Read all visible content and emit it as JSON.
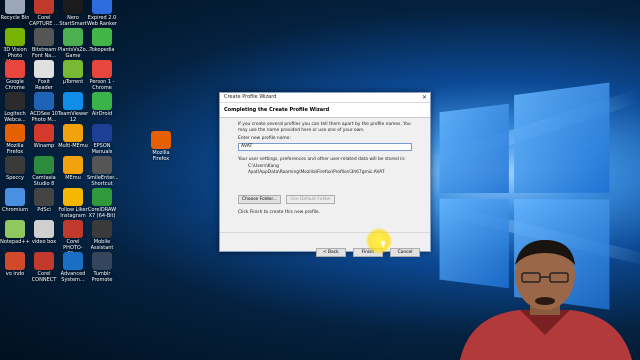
{
  "desktop": {
    "icons": [
      {
        "label": "Recycle Bin",
        "color": "#9aa7b8",
        "icon": "recycle-bin-icon"
      },
      {
        "label": "Corel\nCAPTURE ...",
        "color": "#c0392b",
        "icon": "corel-capture-icon"
      },
      {
        "label": "Nero\nStartSmart",
        "color": "#1b1b1b",
        "icon": "nero-icon"
      },
      {
        "label": "Expired 2.0\nWeb Ranker",
        "color": "#2d6cdf",
        "icon": "web-ranker-icon"
      },
      {
        "label": "3D Vision\nPhoto Viewer",
        "color": "#77b300",
        "icon": "3d-vision-icon"
      },
      {
        "label": "Bitstream\nFont Na...",
        "color": "#555555",
        "icon": "bitstream-icon"
      },
      {
        "label": "PlantsVsZo...\nGame",
        "color": "#4caf50",
        "icon": "plants-vs-zombies-icon"
      },
      {
        "label": "Tokopedia",
        "color": "#42b549",
        "icon": "tokopedia-icon"
      },
      {
        "label": "Google\nChrome",
        "color": "#e8453c",
        "icon": "chrome-icon"
      },
      {
        "label": "Foxit Reader",
        "color": "#e0e0e0",
        "icon": "foxit-reader-icon"
      },
      {
        "label": "μTorrent",
        "color": "#78b833",
        "icon": "utorrent-icon"
      },
      {
        "label": "Person 1 -\nChrome",
        "color": "#e8453c",
        "icon": "chrome-icon"
      },
      {
        "label": "Logitech\nWebca...",
        "color": "#2b2b2b",
        "icon": "logitech-icon"
      },
      {
        "label": "ACDSee 10\nPhoto M...",
        "color": "#1e63b5",
        "icon": "acdsee-icon"
      },
      {
        "label": "TeamViewer\n12",
        "color": "#0e8ee9",
        "icon": "teamviewer-icon"
      },
      {
        "label": "AirDroid",
        "color": "#3ab34a",
        "icon": "airdroid-icon"
      },
      {
        "label": "Mozilla\nFirefox",
        "color": "#e66000",
        "icon": "firefox-icon"
      },
      {
        "label": "Winamp",
        "color": "#d33a2c",
        "icon": "winamp-icon"
      },
      {
        "label": "Multi-MEmu",
        "color": "#f2a20c",
        "icon": "memu-icon"
      },
      {
        "label": "EPSON\nManuals",
        "color": "#1e3f96",
        "icon": "epson-icon"
      },
      {
        "label": "Speccy",
        "color": "#3a3a3a",
        "icon": "speccy-icon"
      },
      {
        "label": "Camtasia\nStudio 8",
        "color": "#2d8c3c",
        "icon": "camtasia-icon"
      },
      {
        "label": "MEmu",
        "color": "#f2a20c",
        "icon": "memu-icon"
      },
      {
        "label": "SmileEnter...\nShortcut",
        "color": "#555555",
        "icon": "shortcut-icon"
      },
      {
        "label": "Chromium",
        "color": "#4a90e2",
        "icon": "chromium-icon"
      },
      {
        "label": "PdSci",
        "color": "#444444",
        "icon": "pdsci-icon"
      },
      {
        "label": "Follow Liker\nInstagram",
        "color": "#f5b700",
        "icon": "follow-liker-icon"
      },
      {
        "label": "CorelDRAW\nX7 (64-Bit)",
        "color": "#2f9a3a",
        "icon": "coreldraw-icon"
      },
      {
        "label": "Notepad++",
        "color": "#8fc85f",
        "icon": "notepad-plus-icon"
      },
      {
        "label": "video box",
        "color": "#cfcfcf",
        "icon": "video-box-icon"
      },
      {
        "label": "Corel\nPHOTO-PA...",
        "color": "#c0392b",
        "icon": "corel-photopaint-icon"
      },
      {
        "label": "Mobile\nAssistant",
        "color": "#3a3a3a",
        "icon": "mobile-assistant-icon"
      },
      {
        "label": "vo indo",
        "color": "#d04a2a",
        "icon": "vo-indo-icon"
      },
      {
        "label": "Corel\nCONNECT",
        "color": "#c0392b",
        "icon": "corel-connect-icon"
      },
      {
        "label": "Advanced\nSystem...",
        "color": "#1a6fc4",
        "icon": "advanced-system-icon"
      },
      {
        "label": "Tumblr\nPromote",
        "color": "#35465c",
        "icon": "tumblr-icon"
      },
      {
        "label": "Mozilla\nFirefox",
        "color": "#e66000",
        "icon": "firefox-icon"
      }
    ]
  },
  "dialog": {
    "title": "Create Profile Wizard",
    "close_symbol": "✕",
    "header": "Completing the Create Profile Wizard",
    "intro": "If you create several profiles you can tell them apart by the profile names. You may use the name provided here or use one of your own.",
    "name_label": "Enter new profile name:",
    "name_value": "AVAT",
    "settings_text": "Your user settings, preferences and other user-related data will be stored in:",
    "path_text": "C:\\Users\\Kang Ayat\\AppData\\Roaming\\Mozilla\\Firefox\\Profiles\\3h67gmic.AVAT",
    "choose_folder": "Choose Folder...",
    "use_default": "Use Default Folder",
    "finish_hint": "Click Finish to create this new profile.",
    "back": "< Back",
    "finish": "Finish",
    "cancel": "Cancel"
  }
}
